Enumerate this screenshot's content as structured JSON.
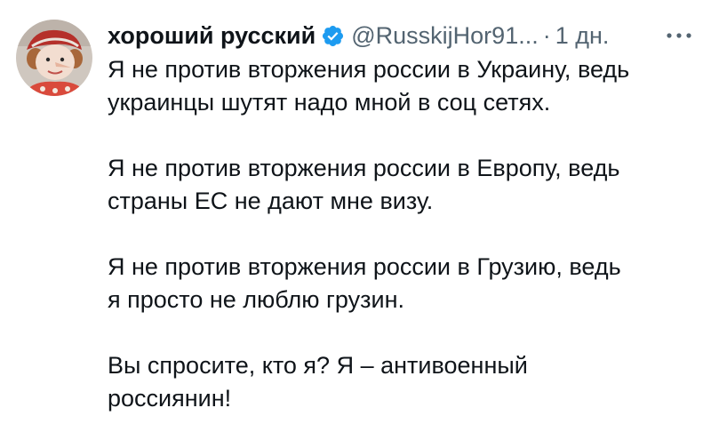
{
  "tweet": {
    "display_name": "хороший русский",
    "verified_icon": "verified-badge-icon",
    "handle": "@RusskijHor91...",
    "separator": "·",
    "time": "1 дн.",
    "more_icon": "more-horizontal-icon",
    "avatar_icon": "user-avatar-icon",
    "accent_color": "#1d9bf0",
    "paragraphs": [
      {
        "lines": [
          "Я не против вторжения россии в Украину, ведь",
          "украинцы шутят надо мной в соц сетях."
        ]
      },
      {
        "lines": [
          "Я не против вторжения россии в Европу, ведь",
          "страны ЕС не дают мне визу."
        ]
      },
      {
        "lines": [
          "Я не против вторжения россии в Грузию, ведь",
          "я просто не люблю грузин."
        ]
      },
      {
        "lines": [
          "Вы спросите, кто я? Я – антивоенный",
          "россиянин!"
        ]
      }
    ]
  }
}
